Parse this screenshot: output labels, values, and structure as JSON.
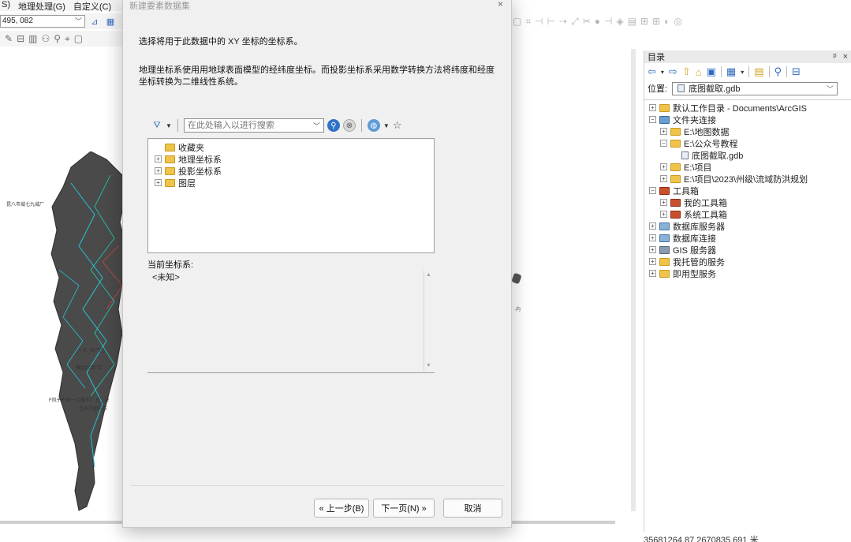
{
  "app": {
    "menu": [
      "S)",
      "地理处理(G)",
      "自定义(C)"
    ],
    "scale_value": "495, 082"
  },
  "map": {
    "labels": [
      {
        "text": "昆八市城七九城厂"
      },
      {
        "text": "_> 凡_世户区"
      },
      {
        "text": "雅比六城T交"
      },
      {
        "text": "F风子乡城一六城乡厂 氏_ 浒"
      },
      {
        "text": "也乡乙侧内东"
      }
    ],
    "dot_label": "·内"
  },
  "catalog": {
    "title": "目录",
    "pin_label": "ᵖ",
    "close_label": "×",
    "location_label": "位置:",
    "location_value": "底图截取.gdb",
    "tree": [
      {
        "label": "默认工作目录 - Documents\\ArcGIS",
        "expander": "⊞",
        "indent": 0,
        "kind": "home"
      },
      {
        "label": "文件夹连接",
        "expander": "⊟",
        "indent": 0,
        "kind": "conn"
      },
      {
        "label": "E:\\地图数据",
        "expander": "⊞",
        "indent": 1,
        "kind": "folder"
      },
      {
        "label": "E:\\公众号教程",
        "expander": "⊟",
        "indent": 1,
        "kind": "folder"
      },
      {
        "label": "底图截取.gdb",
        "expander": "",
        "indent": 2,
        "kind": "gdb"
      },
      {
        "label": "E:\\项目",
        "expander": "⊞",
        "indent": 1,
        "kind": "folder"
      },
      {
        "label": "E:\\项目\\2023\\州级\\流域防洪规划",
        "expander": "⊞",
        "indent": 1,
        "kind": "folder"
      },
      {
        "label": "工具箱",
        "expander": "⊟",
        "indent": 0,
        "kind": "tool"
      },
      {
        "label": "我的工具箱",
        "expander": "⊞",
        "indent": 1,
        "kind": "tool"
      },
      {
        "label": "系统工具箱",
        "expander": "⊞",
        "indent": 1,
        "kind": "tool"
      },
      {
        "label": "数据库服务器",
        "expander": "⊞",
        "indent": 0,
        "kind": "db"
      },
      {
        "label": "数据库连接",
        "expander": "⊞",
        "indent": 0,
        "kind": "db"
      },
      {
        "label": "GIS 服务器",
        "expander": "⊞",
        "indent": 0,
        "kind": "gis"
      },
      {
        "label": "我托管的服务",
        "expander": "⊞",
        "indent": 0,
        "kind": "folder"
      },
      {
        "label": "即用型服务",
        "expander": "⊞",
        "indent": 0,
        "kind": "folder"
      }
    ],
    "status_coords": "35681264.87  2670835.691 米"
  },
  "dialog": {
    "title": "新建要素数据集",
    "close": "×",
    "instruction": "选择将用于此数据中的 XY 坐标的坐标系。",
    "description": "地理坐标系使用用地球表面模型的经纬度坐标。而投影坐标系采用数学转换方法将纬度和经度坐标转换为二维线性系统。",
    "search_placeholder": "在此处输入以进行搜索",
    "tree": [
      {
        "label": "收藏夹",
        "expander": "",
        "kind": "fav"
      },
      {
        "label": "地理坐标系",
        "expander": "⊞",
        "kind": "folder"
      },
      {
        "label": "投影坐标系",
        "expander": "⊞",
        "kind": "folder"
      },
      {
        "label": "图层",
        "expander": "⊞",
        "kind": "folder"
      }
    ],
    "current_label": "当前坐标系:",
    "current_value": "<未知>",
    "buttons": {
      "back": "« 上一步(B)",
      "next": "下一页(N) »",
      "cancel": "取消"
    }
  }
}
